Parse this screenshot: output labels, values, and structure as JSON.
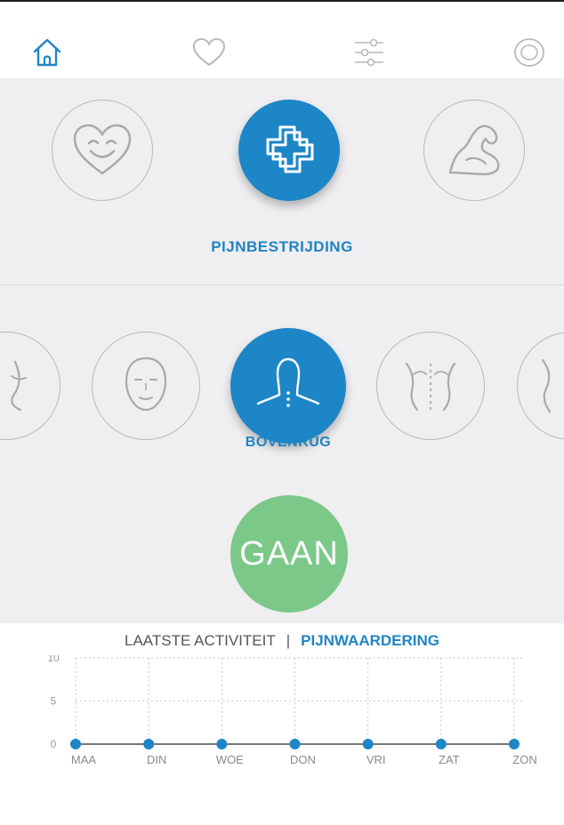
{
  "nav": {
    "icons": [
      "home-icon",
      "heart-outline-icon",
      "sliders-icon",
      "target-icon"
    ],
    "active_color": "#1d86c7",
    "inactive_color": "#b9b9bc"
  },
  "categories": {
    "items": [
      "smiling-heart-icon",
      "medical-cross-icon",
      "flexed-arm-icon"
    ],
    "selected_label": "PIJNBESTRIJDING"
  },
  "body_areas": {
    "items": [
      "lower-back-icon",
      "face-icon",
      "neck-shoulders-icon",
      "upper-back-spine-icon",
      "side-body-icon"
    ],
    "selected_label": "BOVENRUG"
  },
  "go_button": {
    "label": "GAAN",
    "color": "#7cc889"
  },
  "chart_tabs": {
    "left": "LAATSTE ACTIVITEIT",
    "separator": "|",
    "right": "PIJNWAARDERING"
  },
  "chart_data": {
    "type": "line",
    "categories": [
      "MAA",
      "DIN",
      "WOE",
      "DON",
      "VRI",
      "ZAT",
      "ZON"
    ],
    "values": [
      0,
      0,
      0,
      0,
      0,
      0,
      0
    ],
    "y_ticks": [
      "10",
      "5",
      "0"
    ],
    "ylim": [
      0,
      10
    ],
    "grid": true,
    "color": "#1d86c7"
  }
}
